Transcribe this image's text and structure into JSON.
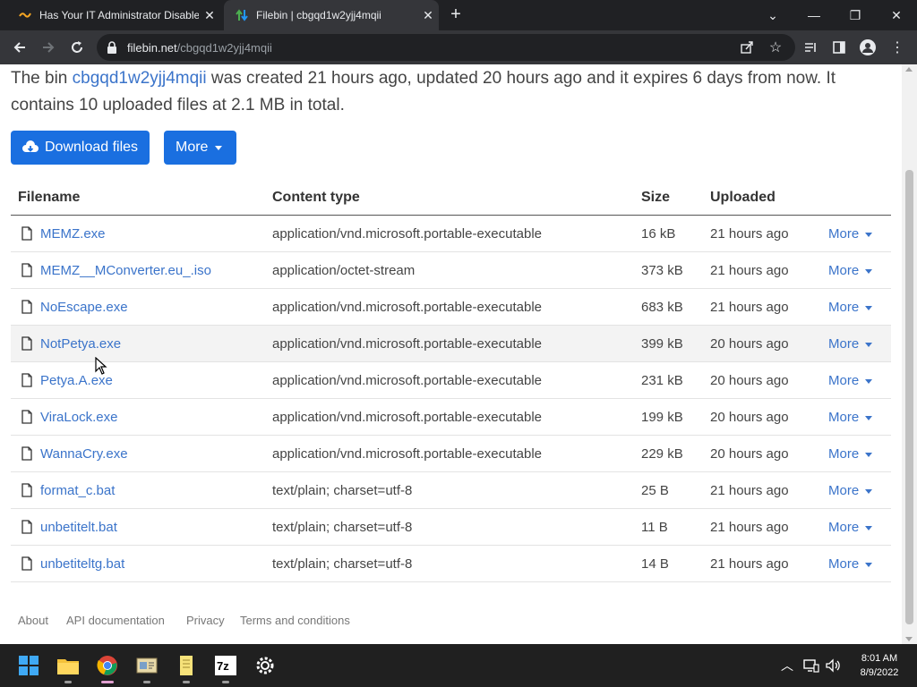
{
  "browser": {
    "tabs": [
      {
        "title": "Has Your IT Administrator Disable",
        "active": false
      },
      {
        "title": "Filebin | cbgqd1w2yjj4mqii",
        "active": true
      }
    ],
    "url_host": "filebin.net",
    "url_path": "/cbgqd1w2yjj4mqii"
  },
  "summary": {
    "p1": "The bin ",
    "bin_id": "cbgqd1w2yjj4mqii",
    "p2": " was created 21 hours ago, updated 20 hours ago and it expires 6 days from now. It contains 10 uploaded files at 2.1 MB in total."
  },
  "actions": {
    "download": "Download files",
    "more": "More"
  },
  "table": {
    "headers": {
      "filename": "Filename",
      "content_type": "Content type",
      "size": "Size",
      "uploaded": "Uploaded"
    },
    "rows": [
      {
        "filename": "MEMZ.exe",
        "content_type": "application/vnd.microsoft.portable-executable",
        "size": "16 kB",
        "uploaded": "21 hours ago",
        "more": "More"
      },
      {
        "filename": "MEMZ__MConverter.eu_.iso",
        "content_type": "application/octet-stream",
        "size": "373 kB",
        "uploaded": "21 hours ago",
        "more": "More"
      },
      {
        "filename": "NoEscape.exe",
        "content_type": "application/vnd.microsoft.portable-executable",
        "size": "683 kB",
        "uploaded": "21 hours ago",
        "more": "More"
      },
      {
        "filename": "NotPetya.exe",
        "content_type": "application/vnd.microsoft.portable-executable",
        "size": "399 kB",
        "uploaded": "20 hours ago",
        "more": "More"
      },
      {
        "filename": "Petya.A.exe",
        "content_type": "application/vnd.microsoft.portable-executable",
        "size": "231 kB",
        "uploaded": "20 hours ago",
        "more": "More"
      },
      {
        "filename": "ViraLock.exe",
        "content_type": "application/vnd.microsoft.portable-executable",
        "size": "199 kB",
        "uploaded": "20 hours ago",
        "more": "More"
      },
      {
        "filename": "WannaCry.exe",
        "content_type": "application/vnd.microsoft.portable-executable",
        "size": "229 kB",
        "uploaded": "20 hours ago",
        "more": "More"
      },
      {
        "filename": "format_c.bat",
        "content_type": "text/plain; charset=utf-8",
        "size": "25 B",
        "uploaded": "21 hours ago",
        "more": "More"
      },
      {
        "filename": "unbetitelt.bat",
        "content_type": "text/plain; charset=utf-8",
        "size": "11 B",
        "uploaded": "21 hours ago",
        "more": "More"
      },
      {
        "filename": "unbetiteltg.bat",
        "content_type": "text/plain; charset=utf-8",
        "size": "14 B",
        "uploaded": "21 hours ago",
        "more": "More"
      }
    ]
  },
  "footer": {
    "about": "About",
    "api": "API documentation",
    "privacy": "Privacy",
    "terms": "Terms and conditions"
  },
  "taskbar": {
    "time": "8:01 AM",
    "date": "8/9/2022",
    "apps": [
      "start-icon",
      "file-explorer-icon",
      "chrome-icon",
      "notepad-icon",
      "notes-icon",
      "7zip-icon",
      "settings-icon"
    ]
  },
  "colors": {
    "link": "#3b74ca",
    "button": "#1a6fe0",
    "browser_dark": "#202124",
    "browser_toolbar": "#35363a"
  }
}
